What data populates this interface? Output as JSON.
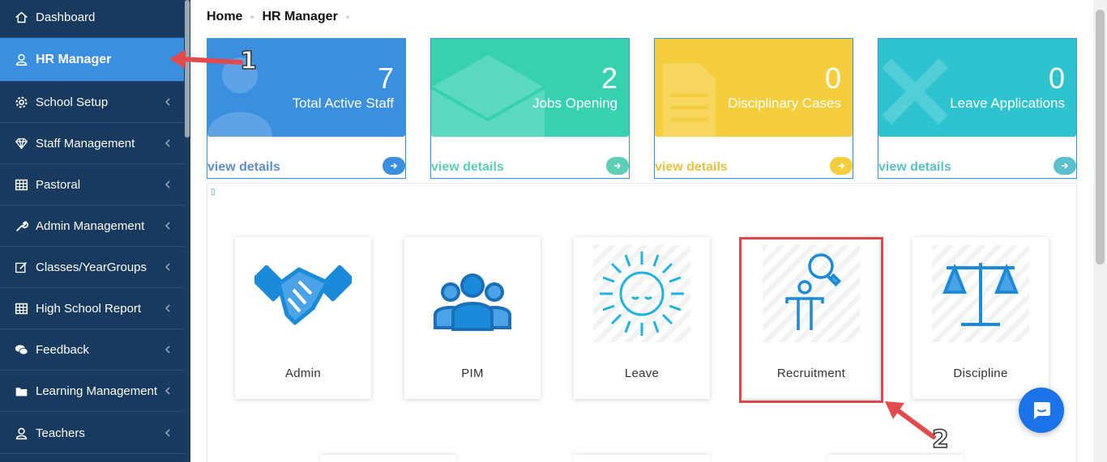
{
  "sidebar": {
    "items": [
      {
        "label": "Dashboard",
        "icon": "home-icon",
        "active": false,
        "has_chevron": false
      },
      {
        "label": "HR Manager",
        "icon": "user-icon",
        "active": true,
        "has_chevron": false
      },
      {
        "label": "School Setup",
        "icon": "gear-icon",
        "active": false,
        "has_chevron": true
      },
      {
        "label": "Staff Management",
        "icon": "diamond-icon",
        "active": false,
        "has_chevron": true
      },
      {
        "label": "Pastoral",
        "icon": "table-icon",
        "active": false,
        "has_chevron": true
      },
      {
        "label": "Admin Management",
        "icon": "wrench-icon",
        "active": false,
        "has_chevron": true
      },
      {
        "label": "Classes/YearGroups",
        "icon": "edit-icon",
        "active": false,
        "has_chevron": true
      },
      {
        "label": "High School Report",
        "icon": "table-icon",
        "active": false,
        "has_chevron": true
      },
      {
        "label": "Feedback",
        "icon": "chat-bubbles-icon",
        "active": false,
        "has_chevron": true
      },
      {
        "label": "Learning Management",
        "icon": "folder-icon",
        "active": false,
        "has_chevron": true
      },
      {
        "label": "Teachers",
        "icon": "user-icon",
        "active": false,
        "has_chevron": true
      }
    ]
  },
  "breadcrumb": {
    "home": "Home",
    "current": "HR Manager"
  },
  "stats": [
    {
      "value": "7",
      "label": "Total Active Staff",
      "link": "view details",
      "color": "#3a8fe0",
      "text_color": "#5b8fd0"
    },
    {
      "value": "2",
      "label": "Jobs Opening",
      "link": "view details",
      "color": "#36d1b0",
      "text_color": "#5ccfb5"
    },
    {
      "value": "0",
      "label": "Disciplinary Cases",
      "link": "view details",
      "color": "#f4ce3c",
      "text_color": "#e9c23f"
    },
    {
      "value": "0",
      "label": "Leave Applications",
      "link": "view details",
      "color": "#2ec4cf",
      "text_color": "#5bbfcc"
    }
  ],
  "modules": [
    {
      "label": "Admin",
      "icon": "handshake-icon"
    },
    {
      "label": "PIM",
      "icon": "group-icon"
    },
    {
      "label": "Leave",
      "icon": "sun-icon"
    },
    {
      "label": "Recruitment",
      "icon": "recruitment-icon"
    },
    {
      "label": "Discipline",
      "icon": "scales-icon"
    }
  ],
  "annotations": {
    "first": "1",
    "second": "2"
  },
  "colors": {
    "sidebar_bg": "#173a5e",
    "active_bg": "#3a8fe0",
    "icon_blue": "#1b8ad8",
    "highlight_red": "#e0474c"
  }
}
